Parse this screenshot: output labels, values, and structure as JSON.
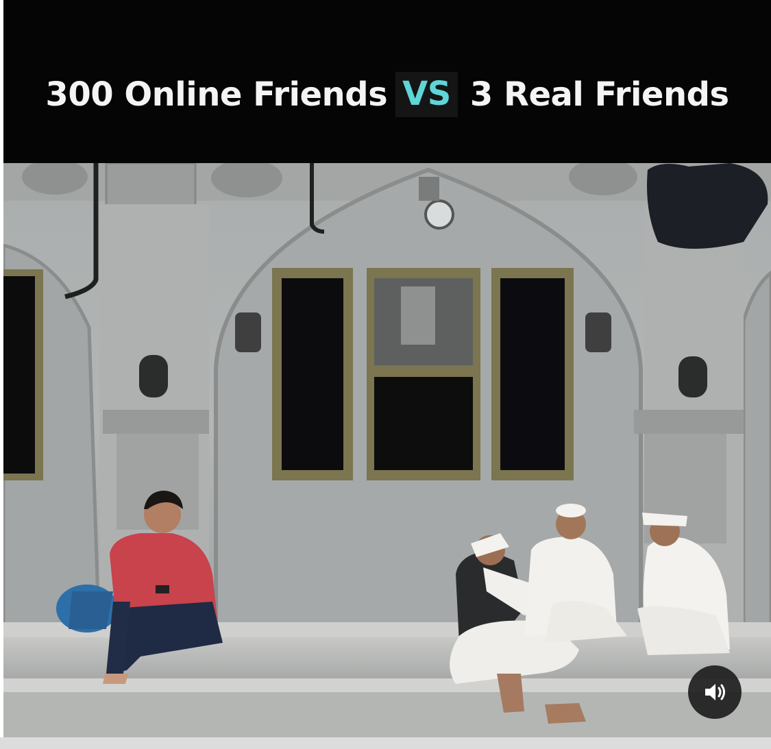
{
  "caption": {
    "left": "300 Online Friends",
    "vs": "VS",
    "right": "3 Real Friends",
    "vs_color": "#5fd5d8"
  },
  "photo": {
    "scene": "man on phone alone vs three elders talking on steps"
  },
  "controls": {
    "sound_icon": "speaker-volume-icon"
  }
}
